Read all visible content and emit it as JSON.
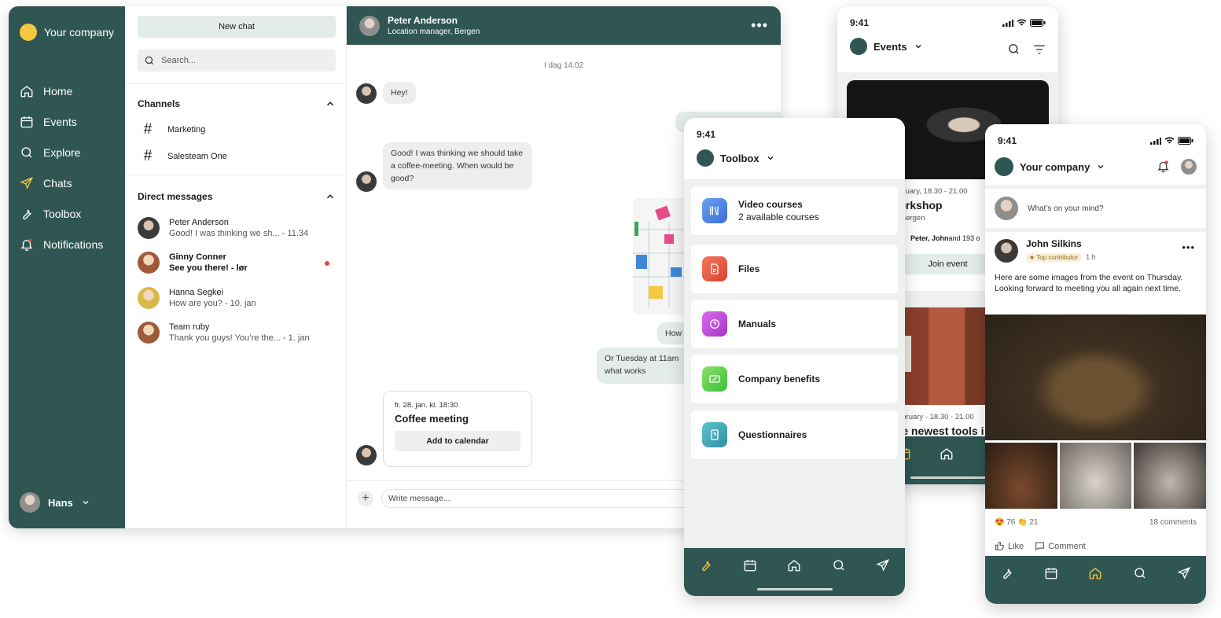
{
  "desktop": {
    "brand": "Your company",
    "nav": [
      {
        "label": "Home",
        "icon": "home-icon"
      },
      {
        "label": "Events",
        "icon": "calendar-icon"
      },
      {
        "label": "Explore",
        "icon": "search-icon"
      },
      {
        "label": "Chats",
        "icon": "send-icon"
      },
      {
        "label": "Toolbox",
        "icon": "wrench-icon"
      },
      {
        "label": "Notifications",
        "icon": "bell-icon"
      }
    ],
    "user": "Hans",
    "new_chat": "New chat",
    "search_placeholder": "Search...",
    "channels_heading": "Channels",
    "channels": [
      "Marketing",
      "Salesteam One"
    ],
    "dm_heading": "Direct messages",
    "dms": [
      {
        "name": "Peter Anderson",
        "preview": "Good! I was thinking we sh...  -  11.34"
      },
      {
        "name": "Ginny Conner",
        "preview": "See you there!  -  lør"
      },
      {
        "name": "Hanna Segkei",
        "preview": "How are you?  -  10. jan"
      },
      {
        "name": "Team ruby",
        "preview": "Thank you guys! You’re the...  -  1. jan"
      }
    ],
    "chat": {
      "contact_name": "Peter Anderson",
      "contact_role": "Location manager, Bergen",
      "day": "I dag 14.02",
      "msg1": "Hey!",
      "msg2": "Good! I was thinking we should take a coffee-meeting. When would be good?",
      "msg3": "How",
      "msg4a": "Or Tuesday at 11am",
      "msg4b": "what works",
      "event_date": "fr. 28. jan. kl. 18:30",
      "event_name": "Coffee meeting",
      "event_button": "Add to calendar",
      "input_placeholder": "Write message..."
    }
  },
  "events_phone": {
    "time": "9:41",
    "title": "Events",
    "event1": {
      "date": "Friday,  28 January,  18.30 - 21.00",
      "name": "Sales workshop",
      "location": "Grieghallen, Bergen",
      "people": "Peter, John",
      "people_more": " and 193 o",
      "button": "Join event"
    },
    "event2": {
      "date": "Friday,  12 February  -  18.30 - 21.00",
      "name": "Learn the newest tools i"
    }
  },
  "toolbox_phone": {
    "time": "9:41",
    "title": "Toolbox",
    "items": [
      {
        "label": "Video courses",
        "sub": "2 available courses",
        "color": "#4a7de0"
      },
      {
        "label": "Files",
        "color": "#e85a45"
      },
      {
        "label": "Manuals",
        "color": "#c44ad6"
      },
      {
        "label": "Company benefits",
        "color": "#5fcf4a"
      },
      {
        "label": "Questionnaires",
        "color": "#3b9fb0"
      }
    ]
  },
  "feed_phone": {
    "time": "9:41",
    "title": "Your company",
    "mind_placeholder": "What’s on your mind?",
    "author": "John Silkins",
    "badge": "Top contributor",
    "time_ago": "1 h",
    "text": "Here are some images from the event on Thursday. Looking forward to meeting you all again next time.",
    "reactions": "76 👏 21",
    "comments": "18 comments",
    "like": "Like",
    "comment": "Comment"
  },
  "colors": {
    "primary": "#2f5652",
    "accent": "#f5c842",
    "unread": "#e04b3a"
  }
}
